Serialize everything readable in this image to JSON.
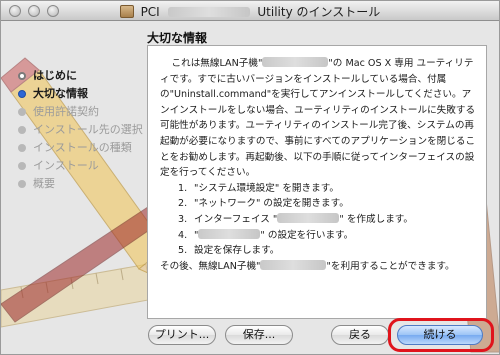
{
  "window": {
    "title_prefix": "PCI",
    "title_suffix": "Utility のインストール"
  },
  "sidebar": {
    "steps": [
      {
        "label": "はじめに",
        "state": "done"
      },
      {
        "label": "大切な情報",
        "state": "current"
      },
      {
        "label": "使用許諾契約",
        "state": "pending"
      },
      {
        "label": "インストール先の選択",
        "state": "pending"
      },
      {
        "label": "インストールの種類",
        "state": "pending"
      },
      {
        "label": "インストール",
        "state": "pending"
      },
      {
        "label": "概要",
        "state": "pending"
      }
    ]
  },
  "main": {
    "heading": "大切な情報",
    "intro_a": "これは無線LAN子機\"",
    "intro_b": "\"の Mac OS X 専用 ユーティリティです。すでに古いバージョンをインストールしている場合、付属の\"Uninstall.command\"を実行してアンインストールしてください。アンインストールをしない場合、ユーティリティのインストールに失敗する可能性があります。ユーティリティのインストール完了後、システムの再起動が必要になりますので、事前にすべてのアプリケーションを閉じることをお勧めします。再起動後、以下の手順に従ってインターフェイスの設定を行ってください。",
    "steps": [
      {
        "num": "1.",
        "text_a": "\"システム環境設定\" を開きます。",
        "text_b": ""
      },
      {
        "num": "2.",
        "text_a": "\"ネットワーク\" の設定を開きます。",
        "text_b": ""
      },
      {
        "num": "3.",
        "text_a": "インターフェイス \"",
        "text_b": "\" を作成します。"
      },
      {
        "num": "4.",
        "text_a": "\"",
        "text_b": "\" の設定を行います。"
      },
      {
        "num": "5.",
        "text_a": "設定を保存します。",
        "text_b": ""
      }
    ],
    "outro_a": "その後、無線LAN子機\"",
    "outro_b": "\"を利用することができます。"
  },
  "buttons": {
    "print": "プリント...",
    "save": "保存...",
    "back": "戻る",
    "continue": "続ける"
  },
  "colors": {
    "highlight_ring": "#e0141c",
    "default_button": "#77aaf0"
  }
}
